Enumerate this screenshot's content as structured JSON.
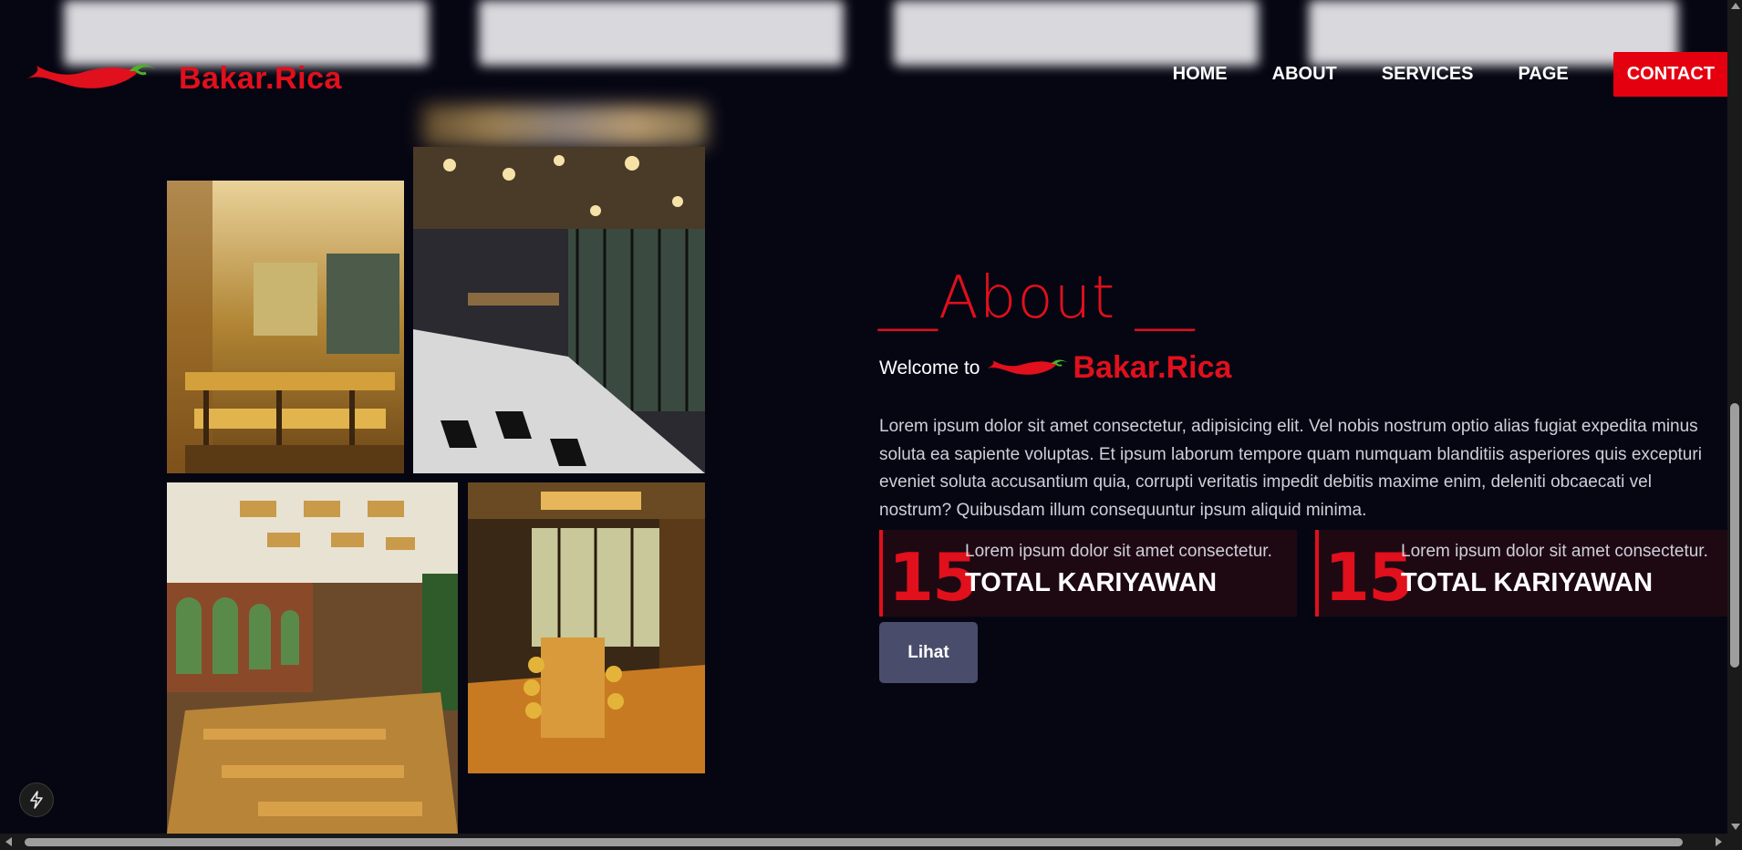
{
  "brand": {
    "name": "Bakar.Rica",
    "accent_color": "#e0101c",
    "logo_icon": "chili-pepper-icon"
  },
  "nav": {
    "items": [
      {
        "label": "HOME"
      },
      {
        "label": "ABOUT"
      },
      {
        "label": "SERVICES"
      },
      {
        "label": "PAGE"
      }
    ],
    "contact_label": "CONTACT"
  },
  "about": {
    "title": "__About __",
    "welcome_label": "Welcome to",
    "welcome_brand": "Bakar.Rica",
    "paragraph": "Lorem ipsum dolor sit amet consectetur, adipisicing elit. Vel nobis nostrum optio alias fugiat expedita minus soluta ea sapiente voluptas. Et ipsum laborum tempore quam numquam blanditiis asperiores quis excepturi eveniet soluta accusantium quia, corrupti veritatis impedit debitis maxime enim, deleniti obcaecati vel nostrum? Quibusdam illum consequuntur ipsum aliquid minima.",
    "stats": [
      {
        "number": "15",
        "description": "Lorem ipsum dolor sit amet consectetur.",
        "title": "TOTAL KARIYAWAN"
      },
      {
        "number": "15",
        "description": "Lorem ipsum dolor sit amet consectetur.",
        "title": "TOTAL KARIYAWAN"
      }
    ],
    "button_label": "Lihat"
  },
  "gallery": [
    {
      "subject": "restaurant-interior-photo"
    },
    {
      "subject": "restaurant-interior-photo"
    },
    {
      "subject": "restaurant-interior-photo"
    },
    {
      "subject": "restaurant-interior-photo"
    }
  ],
  "floating_icon": "bolt-icon",
  "colors": {
    "background": "#060613",
    "contact_button": "#e4000f",
    "lihat_button": "#4a4c6b",
    "stat_background": "#1e0913"
  }
}
